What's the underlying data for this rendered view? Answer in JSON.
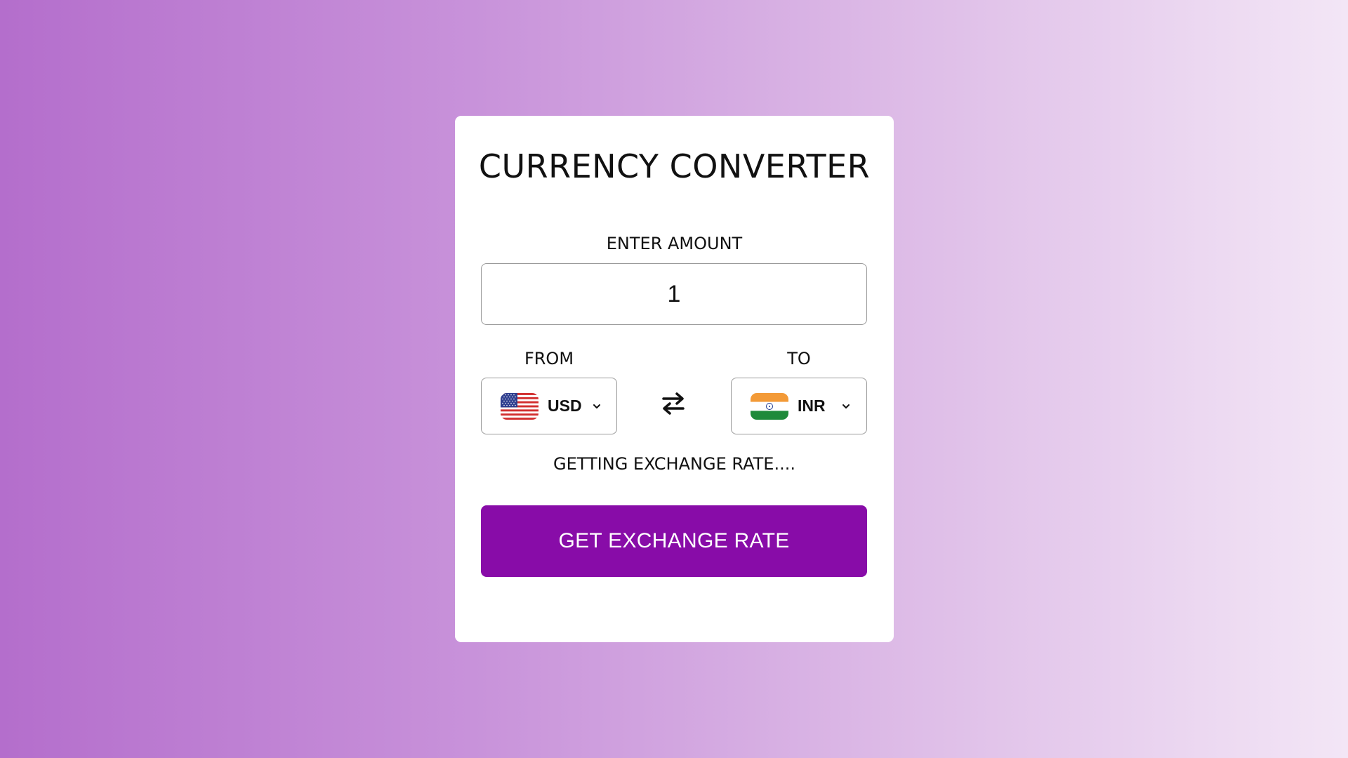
{
  "title": "CURRENCY CONVERTER",
  "amount": {
    "label": "ENTER AMOUNT",
    "value": "1"
  },
  "from": {
    "label": "FROM",
    "currency": "USD",
    "flag_icon": "us-flag-icon"
  },
  "to": {
    "label": "TO",
    "currency": "INR",
    "flag_icon": "india-flag-icon"
  },
  "status_text": "GETTING EXCHANGE RATE....",
  "button_label": "GET EXCHANGE RATE",
  "colors": {
    "button": "#880ca8",
    "gradient_start": "#b46ecc",
    "gradient_end": "#f3e6f6"
  }
}
